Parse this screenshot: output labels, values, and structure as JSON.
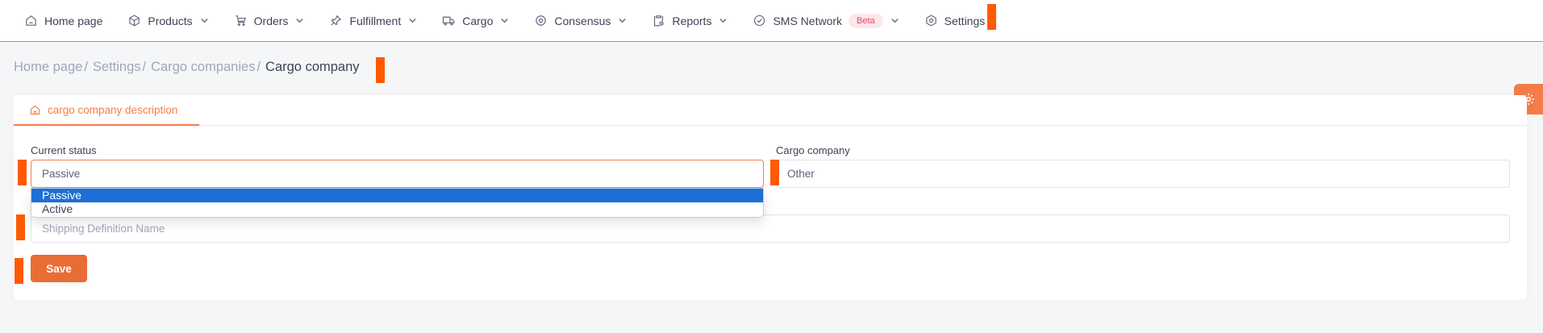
{
  "nav": {
    "items": [
      {
        "label": "Home page",
        "icon": "home-icon",
        "has_dropdown": false
      },
      {
        "label": "Products",
        "icon": "box-icon",
        "has_dropdown": true
      },
      {
        "label": "Orders",
        "icon": "cart-icon",
        "has_dropdown": true
      },
      {
        "label": "Fulfillment",
        "icon": "pin-icon",
        "has_dropdown": true
      },
      {
        "label": "Cargo",
        "icon": "truck-icon",
        "has_dropdown": true
      },
      {
        "label": "Consensus",
        "icon": "sync-icon",
        "has_dropdown": true
      },
      {
        "label": "Reports",
        "icon": "clipboard-icon",
        "has_dropdown": true
      },
      {
        "label": "SMS Network",
        "icon": "check-circle-icon",
        "has_dropdown": true,
        "badge": "Beta"
      },
      {
        "label": "Settings",
        "icon": "hexagon-gear-icon",
        "has_dropdown": false
      }
    ]
  },
  "breadcrumb": {
    "items": [
      "Home page",
      "Settings",
      "Cargo companies"
    ],
    "separator": "/",
    "current": "Cargo company"
  },
  "tab": {
    "label": "cargo company description",
    "icon": "home-icon"
  },
  "form": {
    "status_label": "Current status",
    "status_value": "Passive",
    "status_options": [
      "Passive",
      "Active"
    ],
    "status_selected_index": 0,
    "cargo_label": "Cargo company",
    "cargo_value": "Other",
    "shipping_placeholder": "Shipping Definition Name",
    "save_label": "Save"
  },
  "colors": {
    "accent": "#f47c4a",
    "save_button": "#ea6c35",
    "selected_option": "#1c6fd6",
    "badge_bg": "#fde7ea",
    "badge_text": "#e5476a",
    "marker": "#ff5a00"
  },
  "floating": {
    "icon": "gear-icon"
  }
}
